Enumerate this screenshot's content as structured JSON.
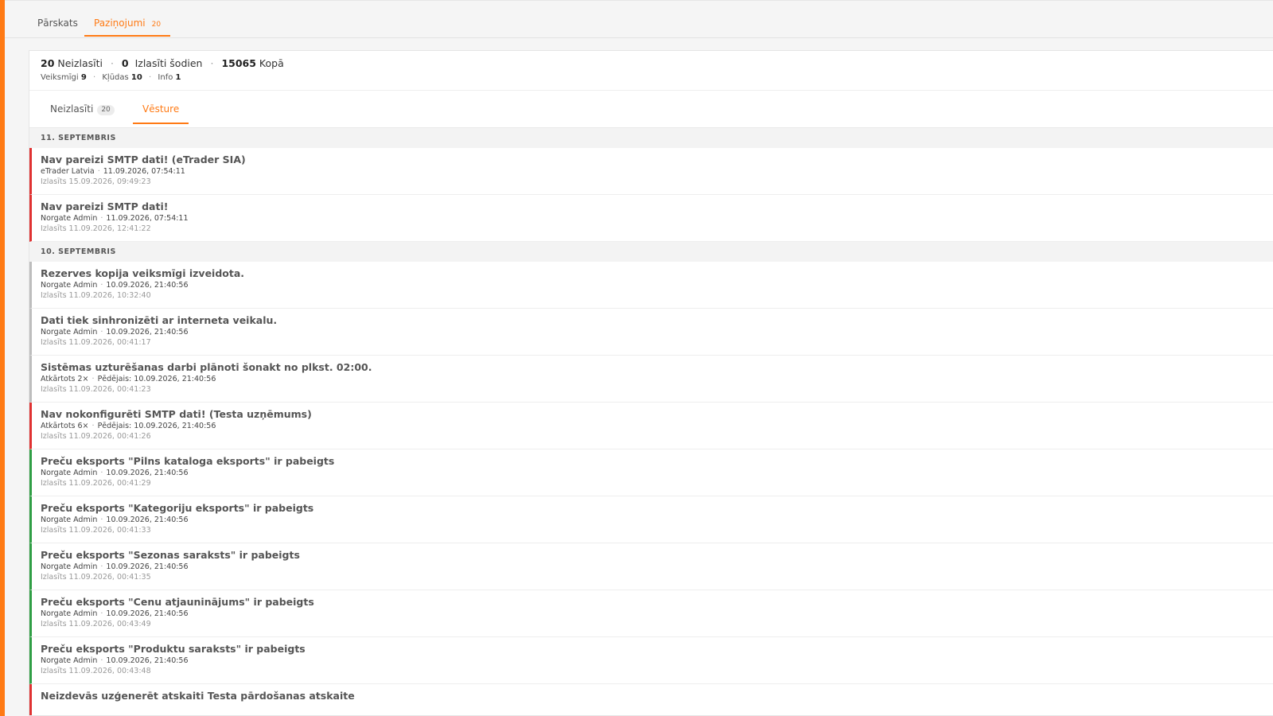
{
  "top_tabs": [
    {
      "label": "Pārskats",
      "active": false
    },
    {
      "label": "Paziņojumi",
      "active": true,
      "count": "20"
    }
  ],
  "stats": {
    "unread_count": "20",
    "unread_label": "Neizlasīti",
    "read_today_count": "0",
    "read_today_label": "Izlasīti šodien",
    "total_count": "15065",
    "total_label": "Kopā"
  },
  "substats": {
    "success_label": "Veiksmīgi",
    "success_count": "9",
    "error_label": "Kļūdas",
    "error_count": "10",
    "info_label": "Info",
    "info_count": "1"
  },
  "sub_tabs": [
    {
      "label": "Neizlasīti",
      "count": "20",
      "active": false
    },
    {
      "label": "Vēsture",
      "active": true
    }
  ],
  "groups": [
    {
      "header": "11. SEPTEMBRIS",
      "items": [
        {
          "type": "error",
          "title": "Nav pareizi SMTP dati! (eTrader SIA)",
          "meta_a": "eTrader Latvia",
          "meta_b": "11.09.2026, 07:54:11",
          "read": "Izlasīts 15.09.2026, 09:49:23"
        },
        {
          "type": "error",
          "title": "Nav pareizi SMTP dati!",
          "meta_a": "Norgate Admin",
          "meta_b": "11.09.2026, 07:54:11",
          "read": "Izlasīts 11.09.2026, 12:41:22"
        }
      ]
    },
    {
      "header": "10. SEPTEMBRIS",
      "items": [
        {
          "type": "info",
          "title": "Rezerves kopija veiksmīgi izveidota.",
          "meta_a": "Norgate Admin",
          "meta_b": "10.09.2026, 21:40:56",
          "read": "Izlasīts 11.09.2026, 10:32:40"
        },
        {
          "type": "info",
          "title": "Dati tiek sinhronizēti ar interneta veikalu.",
          "meta_a": "Norgate Admin",
          "meta_b": "10.09.2026, 21:40:56",
          "read": "Izlasīts 11.09.2026, 00:41:17"
        },
        {
          "type": "info",
          "title": "Sistēmas uzturēšanas darbi plānoti šonakt no plkst. 02:00.",
          "meta_a": "Atkārtots 2×",
          "meta_b": "Pēdējais: 10.09.2026, 21:40:56",
          "read": "Izlasīts 11.09.2026, 00:41:23"
        },
        {
          "type": "error",
          "title": "Nav nokonfigurēti SMTP dati! (Testa uzņēmums)",
          "meta_a": "Atkārtots 6×",
          "meta_b": "Pēdējais: 10.09.2026, 21:40:56",
          "read": "Izlasīts 11.09.2026, 00:41:26"
        },
        {
          "type": "success",
          "title": "Preču eksports \"Pilns kataloga eksports\" ir pabeigts",
          "meta_a": "Norgate Admin",
          "meta_b": "10.09.2026, 21:40:56",
          "read": "Izlasīts 11.09.2026, 00:41:29"
        },
        {
          "type": "success",
          "title": "Preču eksports \"Kategoriju eksports\" ir pabeigts",
          "meta_a": "Norgate Admin",
          "meta_b": "10.09.2026, 21:40:56",
          "read": "Izlasīts 11.09.2026, 00:41:33"
        },
        {
          "type": "success",
          "title": "Preču eksports \"Sezonas saraksts\" ir pabeigts",
          "meta_a": "Norgate Admin",
          "meta_b": "10.09.2026, 21:40:56",
          "read": "Izlasīts 11.09.2026, 00:41:35"
        },
        {
          "type": "success",
          "title": "Preču eksports \"Cenu atjauninājums\" ir pabeigts",
          "meta_a": "Norgate Admin",
          "meta_b": "10.09.2026, 21:40:56",
          "read": "Izlasīts 11.09.2026, 00:43:49"
        },
        {
          "type": "success",
          "title": "Preču eksports \"Produktu saraksts\" ir pabeigts",
          "meta_a": "Norgate Admin",
          "meta_b": "10.09.2026, 21:40:56",
          "read": "Izlasīts 11.09.2026, 00:43:48"
        },
        {
          "type": "error",
          "title": "Neizdevās uzģenerēt atskaiti Testa pārdošanas atskaite",
          "meta_a": "",
          "meta_b": "",
          "read": ""
        }
      ]
    }
  ],
  "colors": {
    "accent": "#ff7a14",
    "error": "#e03131",
    "success": "#2f9e44",
    "info": "#bdbdbd"
  }
}
